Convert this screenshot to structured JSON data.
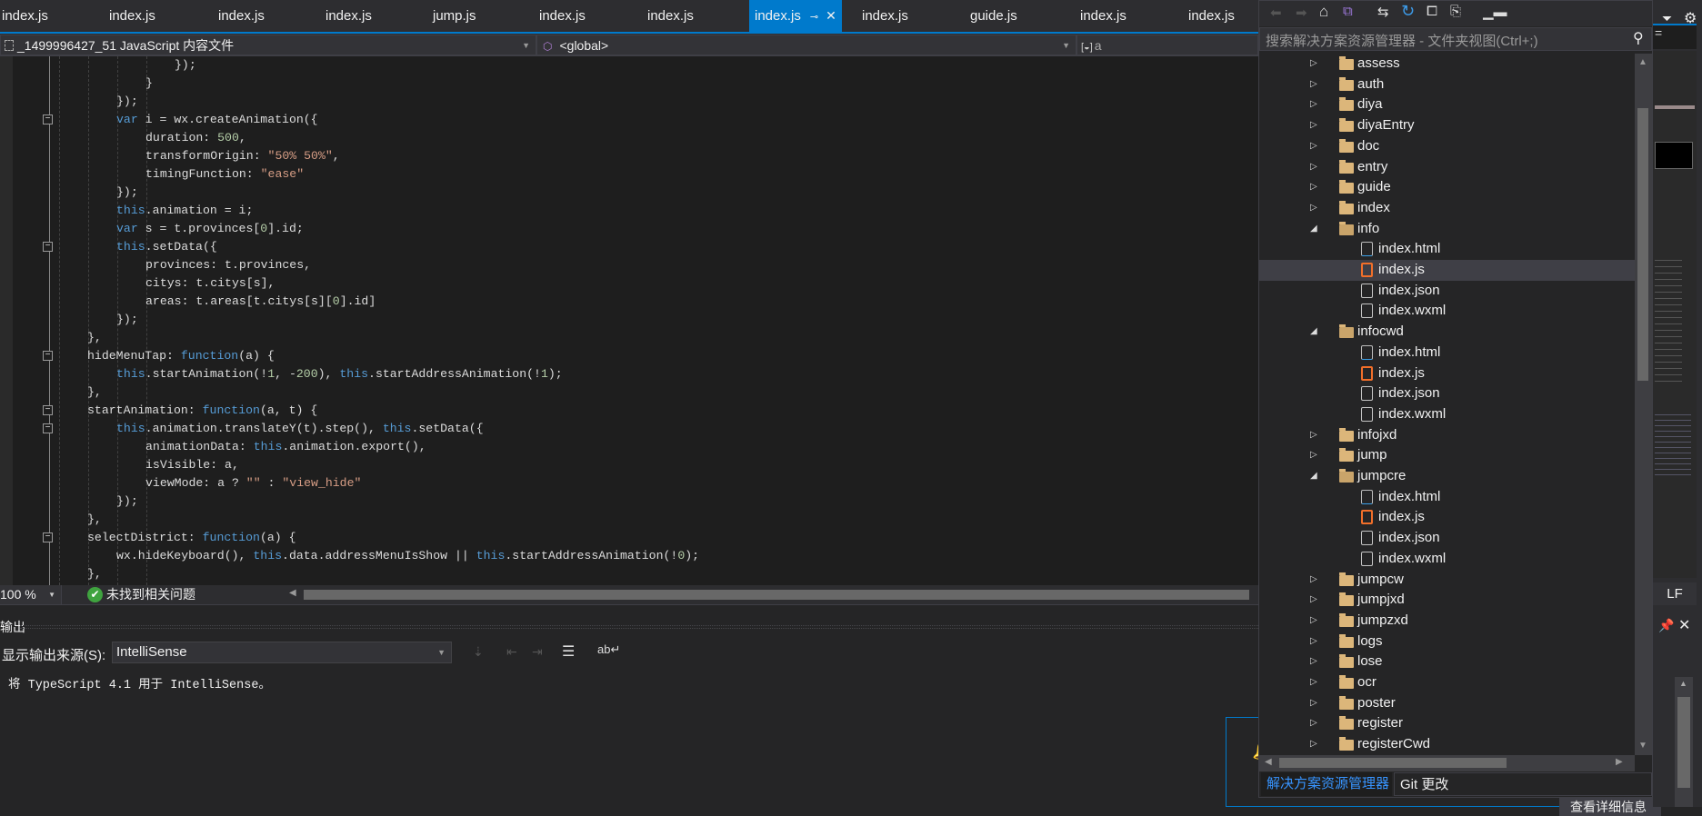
{
  "tabs": [
    {
      "label": "index.js"
    },
    {
      "label": "index.js"
    },
    {
      "label": "index.js"
    },
    {
      "label": "index.js"
    },
    {
      "label": "jump.js"
    },
    {
      "label": "index.js"
    },
    {
      "label": "index.js"
    },
    {
      "label": "index.js",
      "active": true
    },
    {
      "label": "index.js"
    },
    {
      "label": "guide.js"
    },
    {
      "label": "index.js"
    },
    {
      "label": "index.js"
    }
  ],
  "navbar": {
    "project": "_1499996427_51 JavaScript 内容文件",
    "scope": "<global>",
    "member": "a"
  },
  "code": {
    "lines": [
      {
        "indent": 4,
        "tokens": [
          {
            "c": "",
            "t": "});"
          }
        ]
      },
      {
        "indent": 3,
        "tokens": [
          {
            "c": "",
            "t": "}"
          }
        ]
      },
      {
        "indent": 2,
        "tokens": [
          {
            "c": "",
            "t": "});"
          }
        ]
      },
      {
        "indent": 2,
        "fold": true,
        "tokens": [
          {
            "c": "kw",
            "t": "var"
          },
          {
            "c": "",
            "t": " i = wx.createAnimation({"
          }
        ]
      },
      {
        "indent": 3,
        "tokens": [
          {
            "c": "",
            "t": "duration: "
          },
          {
            "c": "num",
            "t": "500"
          },
          {
            "c": "",
            "t": ","
          }
        ]
      },
      {
        "indent": 3,
        "tokens": [
          {
            "c": "",
            "t": "transformOrigin: "
          },
          {
            "c": "str",
            "t": "\"50% 50%\""
          },
          {
            "c": "",
            "t": ","
          }
        ]
      },
      {
        "indent": 3,
        "tokens": [
          {
            "c": "",
            "t": "timingFunction: "
          },
          {
            "c": "str",
            "t": "\"ease\""
          }
        ]
      },
      {
        "indent": 2,
        "tokens": [
          {
            "c": "",
            "t": "});"
          }
        ]
      },
      {
        "indent": 2,
        "tokens": [
          {
            "c": "kw",
            "t": "this"
          },
          {
            "c": "",
            "t": ".animation = i;"
          }
        ]
      },
      {
        "indent": 2,
        "tokens": [
          {
            "c": "kw",
            "t": "var"
          },
          {
            "c": "",
            "t": " s = t.provinces["
          },
          {
            "c": "num",
            "t": "0"
          },
          {
            "c": "",
            "t": "].id;"
          }
        ]
      },
      {
        "indent": 2,
        "fold": true,
        "tokens": [
          {
            "c": "kw",
            "t": "this"
          },
          {
            "c": "",
            "t": ".setData({"
          }
        ]
      },
      {
        "indent": 3,
        "tokens": [
          {
            "c": "",
            "t": "provinces: t.provinces,"
          }
        ]
      },
      {
        "indent": 3,
        "tokens": [
          {
            "c": "",
            "t": "citys: t.citys[s],"
          }
        ]
      },
      {
        "indent": 3,
        "tokens": [
          {
            "c": "",
            "t": "areas: t.areas[t.citys[s]["
          },
          {
            "c": "num",
            "t": "0"
          },
          {
            "c": "",
            "t": "].id]"
          }
        ]
      },
      {
        "indent": 2,
        "tokens": [
          {
            "c": "",
            "t": "});"
          }
        ]
      },
      {
        "indent": 1,
        "tokens": [
          {
            "c": "",
            "t": "},"
          }
        ]
      },
      {
        "indent": 1,
        "fold": true,
        "tokens": [
          {
            "c": "",
            "t": "hideMenuTap: "
          },
          {
            "c": "kw",
            "t": "function"
          },
          {
            "c": "",
            "t": "(a) {"
          }
        ]
      },
      {
        "indent": 2,
        "tokens": [
          {
            "c": "kw",
            "t": "this"
          },
          {
            "c": "",
            "t": ".startAnimation(!"
          },
          {
            "c": "num",
            "t": "1"
          },
          {
            "c": "",
            "t": ", -"
          },
          {
            "c": "num",
            "t": "200"
          },
          {
            "c": "",
            "t": "), "
          },
          {
            "c": "kw",
            "t": "this"
          },
          {
            "c": "",
            "t": ".startAddressAnimation(!"
          },
          {
            "c": "num",
            "t": "1"
          },
          {
            "c": "",
            "t": ");"
          }
        ]
      },
      {
        "indent": 1,
        "tokens": [
          {
            "c": "",
            "t": "},"
          }
        ]
      },
      {
        "indent": 1,
        "fold": true,
        "tokens": [
          {
            "c": "",
            "t": "startAnimation: "
          },
          {
            "c": "kw",
            "t": "function"
          },
          {
            "c": "",
            "t": "(a, t) {"
          }
        ]
      },
      {
        "indent": 2,
        "fold": true,
        "tokens": [
          {
            "c": "kw",
            "t": "this"
          },
          {
            "c": "",
            "t": ".animation.translateY(t).step(), "
          },
          {
            "c": "kw",
            "t": "this"
          },
          {
            "c": "",
            "t": ".setData({"
          }
        ]
      },
      {
        "indent": 3,
        "tokens": [
          {
            "c": "",
            "t": "animationData: "
          },
          {
            "c": "kw",
            "t": "this"
          },
          {
            "c": "",
            "t": ".animation.export(),"
          }
        ]
      },
      {
        "indent": 3,
        "tokens": [
          {
            "c": "",
            "t": "isVisible: a,"
          }
        ]
      },
      {
        "indent": 3,
        "tokens": [
          {
            "c": "",
            "t": "viewMode: a ? "
          },
          {
            "c": "str",
            "t": "\"\""
          },
          {
            "c": "",
            "t": " : "
          },
          {
            "c": "str",
            "t": "\"view_hide\""
          }
        ]
      },
      {
        "indent": 2,
        "tokens": [
          {
            "c": "",
            "t": "});"
          }
        ]
      },
      {
        "indent": 1,
        "tokens": [
          {
            "c": "",
            "t": "},"
          }
        ]
      },
      {
        "indent": 1,
        "fold": true,
        "tokens": [
          {
            "c": "",
            "t": "selectDistrict: "
          },
          {
            "c": "kw",
            "t": "function"
          },
          {
            "c": "",
            "t": "(a) {"
          }
        ]
      },
      {
        "indent": 2,
        "tokens": [
          {
            "c": "",
            "t": "wx.hideKeyboard(), "
          },
          {
            "c": "kw",
            "t": "this"
          },
          {
            "c": "",
            "t": ".data.addressMenuIsShow || "
          },
          {
            "c": "kw",
            "t": "this"
          },
          {
            "c": "",
            "t": ".startAddressAnimation(!"
          },
          {
            "c": "num",
            "t": "0"
          },
          {
            "c": "",
            "t": ");"
          }
        ]
      },
      {
        "indent": 1,
        "tokens": [
          {
            "c": "",
            "t": "},"
          }
        ]
      }
    ]
  },
  "status": {
    "zoom": "100 %",
    "issues": "未找到相关问题"
  },
  "output": {
    "title": "输出",
    "source_label": "显示输出来源(S):",
    "source_value": "IntelliSense",
    "text": "将 TypeScript 4.1 用于 IntelliSense。"
  },
  "explorer": {
    "search_placeholder": "搜索解决方案资源管理器 - 文件夹视图(Ctrl+;)",
    "items": [
      {
        "label": "assess",
        "type": "folder"
      },
      {
        "label": "auth",
        "type": "folder"
      },
      {
        "label": "diya",
        "type": "folder"
      },
      {
        "label": "diyaEntry",
        "type": "folder"
      },
      {
        "label": "doc",
        "type": "folder"
      },
      {
        "label": "entry",
        "type": "folder"
      },
      {
        "label": "guide",
        "type": "folder"
      },
      {
        "label": "index",
        "type": "folder"
      },
      {
        "label": "info",
        "type": "folder",
        "expanded": true
      },
      {
        "label": "index.html",
        "type": "file",
        "icon": "html"
      },
      {
        "label": "index.js",
        "type": "file",
        "icon": "js",
        "selected": true
      },
      {
        "label": "index.json",
        "type": "file",
        "icon": "json"
      },
      {
        "label": "index.wxml",
        "type": "file",
        "icon": "doc"
      },
      {
        "label": "infocwd",
        "type": "folder",
        "expanded": true
      },
      {
        "label": "index.html",
        "type": "file",
        "icon": "html"
      },
      {
        "label": "index.js",
        "type": "file",
        "icon": "js"
      },
      {
        "label": "index.json",
        "type": "file",
        "icon": "json"
      },
      {
        "label": "index.wxml",
        "type": "file",
        "icon": "doc"
      },
      {
        "label": "infojxd",
        "type": "folder"
      },
      {
        "label": "jump",
        "type": "folder"
      },
      {
        "label": "jumpcre",
        "type": "folder",
        "expanded": true
      },
      {
        "label": "index.html",
        "type": "file",
        "icon": "html"
      },
      {
        "label": "index.js",
        "type": "file",
        "icon": "js"
      },
      {
        "label": "index.json",
        "type": "file",
        "icon": "json"
      },
      {
        "label": "index.wxml",
        "type": "file",
        "icon": "doc"
      },
      {
        "label": "jumpcw",
        "type": "folder"
      },
      {
        "label": "jumpjxd",
        "type": "folder"
      },
      {
        "label": "jumpzxd",
        "type": "folder"
      },
      {
        "label": "logs",
        "type": "folder"
      },
      {
        "label": "lose",
        "type": "folder"
      },
      {
        "label": "ocr",
        "type": "folder"
      },
      {
        "label": "poster",
        "type": "folder"
      },
      {
        "label": "register",
        "type": "folder"
      },
      {
        "label": "registerCwd",
        "type": "folder"
      }
    ],
    "bottom_tabs": [
      {
        "label": "解决方案资源管理器",
        "active": true
      },
      {
        "label": "Git 更改"
      }
    ]
  },
  "right": {
    "line_ending": "LF"
  },
  "notification": {
    "button": "查看详细信息"
  },
  "colors": {
    "accent": "#007acc",
    "keyword": "#569cd6",
    "string": "#d69d85",
    "number": "#b5cea8",
    "editor_bg": "#1e1e1e"
  }
}
